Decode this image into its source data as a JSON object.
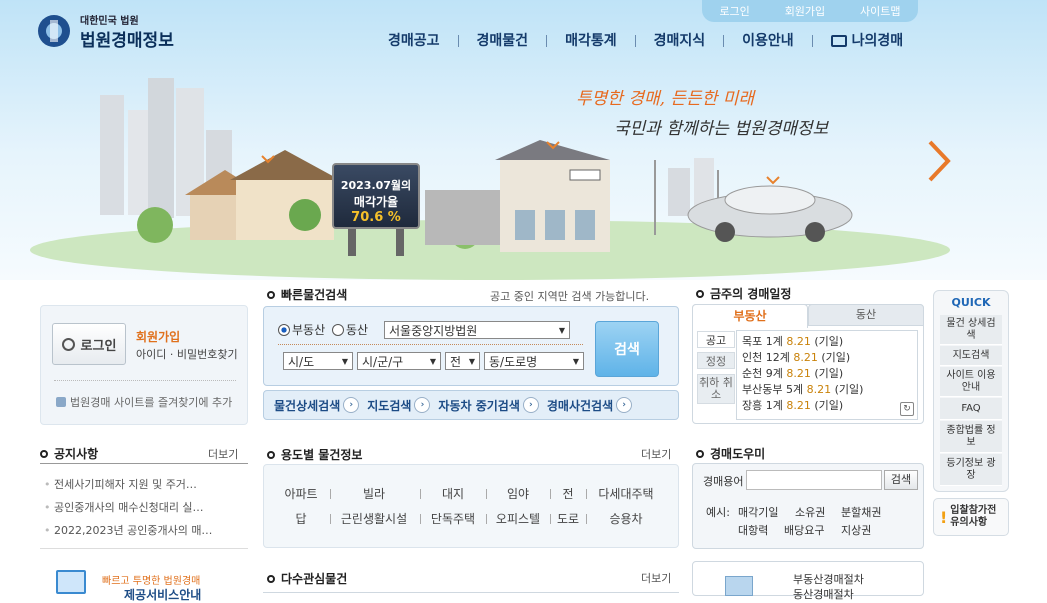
{
  "util": {
    "login": "로그인",
    "join": "회원가입",
    "sitemap": "사이트맵"
  },
  "logo": {
    "sub": "대한민국 법원",
    "main": "법원경매정보"
  },
  "gnb": [
    "경매공고",
    "경매물건",
    "매각통계",
    "경매지식",
    "이용안내",
    "나의경매"
  ],
  "hero": {
    "slogan1": "투명한 경매, 든든한 미래",
    "slogan2": "국민과 함께하는 법원경매정보",
    "board_l1": "2023.07월의",
    "board_l2": "매각가율",
    "board_l3": "70.6 %"
  },
  "login": {
    "button": "로그인",
    "join": "회원가입",
    "find": "아이디 · 비밀번호찾기",
    "favorite": "법원경매 사이트를 즐겨찾기에 추가"
  },
  "notice": {
    "title": "공지사항",
    "more": "더보기",
    "items": [
      "전세사기피해자 지원 및 주거…",
      "공인중개사의 매수신청대리 실…",
      "2022,2023년 공인중개사의 매…"
    ]
  },
  "quickSearch": {
    "title": "빠른물건검색",
    "note": "공고 중인 지역만 검색 가능합니다.",
    "radio1": "부동산",
    "radio2": "동산",
    "court": "서울중앙지방법원",
    "sido": "시/도",
    "sigungu": "시/군/구",
    "jeon": "전",
    "dong": "동/도로명",
    "search": "검색",
    "links": [
      "물건상세검색",
      "지도검색",
      "자동차 중기검색",
      "경매사건검색"
    ]
  },
  "usage": {
    "title": "용도별 물건정보",
    "more": "더보기",
    "row1": [
      "아파트",
      "빌라",
      "대지",
      "임야",
      "전",
      "다세대주택"
    ],
    "row2": [
      "답",
      "근린생활시설",
      "단독주택",
      "오피스텔",
      "도로",
      "승용차"
    ]
  },
  "popular": {
    "title": "다수관심물건",
    "more": "더보기"
  },
  "schedule": {
    "title": "금주의 경매일정",
    "tab1": "부동산",
    "tab2": "동산",
    "types": [
      "공고",
      "정정",
      "취하 취소"
    ],
    "items": [
      {
        "place": "목포 1계",
        "date": "8.21",
        "note": "(기일)"
      },
      {
        "place": "인천 12계",
        "date": "8.21",
        "note": "(기일)"
      },
      {
        "place": "순천 9계",
        "date": "8.21",
        "note": "(기일)"
      },
      {
        "place": "부산동부 5계",
        "date": "8.21",
        "note": "(기일)"
      },
      {
        "place": "장흥 1계",
        "date": "8.21",
        "note": "(기일)"
      }
    ]
  },
  "help": {
    "title": "경매도우미",
    "label": "경매용어",
    "button": "검색",
    "example": "예시:",
    "terms": [
      "매각기일",
      "소유권",
      "분할채권",
      "대항력",
      "배당요구",
      "지상권"
    ]
  },
  "quick": {
    "title": "QUICK",
    "items": [
      "물건 상세검색",
      "지도검색",
      "사이트 이용안내",
      "FAQ",
      "종합법률 정보",
      "등기정보 광장"
    ],
    "ipchal": "입찰참가전 유의사항"
  },
  "bottom": {
    "banner_small": "빠르고 투명한 법원경매",
    "banner_big": "제공서비스안내",
    "law1": "부동산경매절차",
    "law2": "동산경매절차"
  },
  "colors": {
    "navy": "#143a6a",
    "orange": "#e0701c",
    "accent": "#5fb3e8"
  }
}
